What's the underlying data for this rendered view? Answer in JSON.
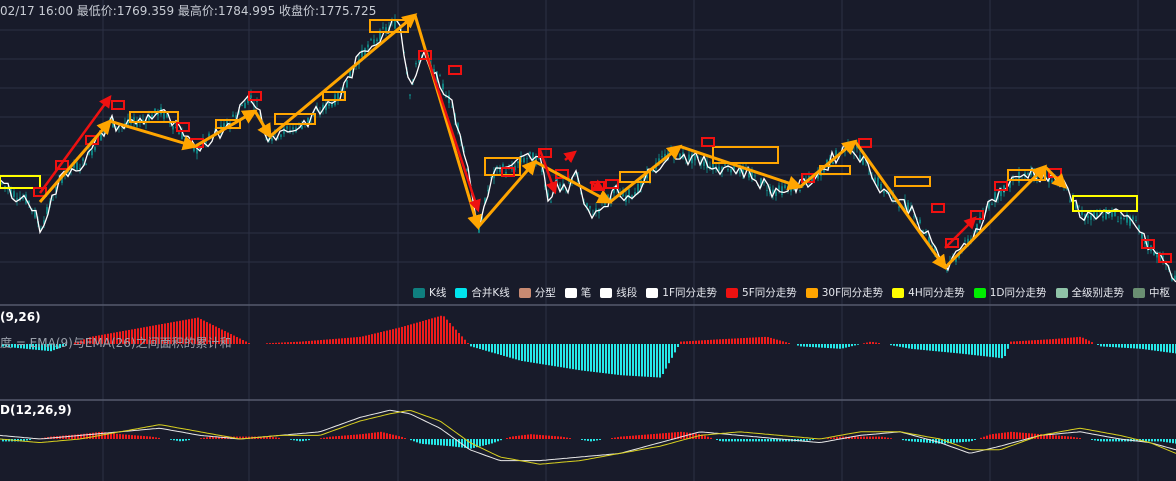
{
  "header": {
    "info": "02/17 16:00 最低价:1769.359 最高价:1784.995 收盘价:1775.725"
  },
  "legend": [
    {
      "label": "K线",
      "color": "#0f7f7f"
    },
    {
      "label": "合并K线",
      "color": "#00e5ee"
    },
    {
      "label": "分型",
      "color": "#c88a72"
    },
    {
      "label": "笔",
      "color": "#ffffff"
    },
    {
      "label": "线段",
      "color": "#ffffff"
    },
    {
      "label": "1F同分走势",
      "color": "#ffffff"
    },
    {
      "label": "5F同分走势",
      "color": "#ee1111"
    },
    {
      "label": "30F同分走势",
      "color": "#ffa500"
    },
    {
      "label": "4H同分走势",
      "color": "#ffff00"
    },
    {
      "label": "1D同分走势",
      "color": "#00ee00"
    },
    {
      "label": "全级别走势",
      "color": "#8fc3a8"
    },
    {
      "label": "中枢",
      "color": "#6a8f72"
    }
  ],
  "panels": {
    "area_title": "(9,26)",
    "area_desc": "度 = EMA(9)与EMA(26)之间面积的累计和",
    "macd_title": "D(12,26,9)"
  },
  "colors": {
    "background": "#181b2a",
    "grid": "#2c3044",
    "up": "#ee1c1c",
    "down": "#26e8e8",
    "kline": "#0f7f7f",
    "bi": "#ffffff",
    "seg30": "#ffa500",
    "seg5": "#ee1111",
    "pivot4h": "#ffff00",
    "dif": "#e8e8e8",
    "dea": "#d8d020"
  },
  "chart_data": [
    {
      "type": "line",
      "name": "price",
      "x": [
        0,
        12,
        30,
        40,
        45,
        55,
        65,
        85,
        110,
        120,
        140,
        160,
        175,
        195,
        205,
        220,
        235,
        250,
        258,
        265,
        270,
        285,
        300,
        320,
        340,
        355,
        365,
        375,
        385,
        400,
        410,
        418,
        425,
        432,
        440,
        450,
        460,
        470,
        478,
        490,
        500,
        510,
        520,
        530,
        540,
        550,
        556,
        565,
        575,
        585,
        595,
        605,
        615,
        625,
        640,
        655,
        670,
        685,
        700,
        715,
        730,
        745,
        760,
        775,
        790,
        800,
        815,
        830,
        845,
        858,
        870,
        885,
        900,
        915,
        930,
        948,
        960,
        975,
        990,
        1005,
        1020,
        1030,
        1045,
        1060,
        1070,
        1085,
        1100,
        1120,
        1135,
        1145,
        1155,
        1165,
        1176
      ],
      "values": [
        1780,
        1778,
        1776,
        1771,
        1773,
        1778,
        1782,
        1784,
        1792,
        1791,
        1792,
        1794,
        1791,
        1786,
        1788,
        1790,
        1793,
        1797,
        1795,
        1790,
        1789,
        1790,
        1791,
        1794,
        1797,
        1803,
        1806,
        1808,
        1810,
        1812,
        1798,
        1804,
        1806,
        1802,
        1800,
        1796,
        1790,
        1780,
        1770,
        1780,
        1783,
        1782,
        1784,
        1785,
        1784,
        1776,
        1780,
        1778,
        1782,
        1775,
        1774,
        1776,
        1778,
        1777,
        1779,
        1783,
        1786,
        1785,
        1784,
        1783,
        1783,
        1782,
        1780,
        1778,
        1779,
        1779,
        1781,
        1784,
        1787,
        1786,
        1782,
        1778,
        1776,
        1774,
        1768,
        1763,
        1766,
        1770,
        1776,
        1779,
        1781,
        1782,
        1781,
        1780,
        1777,
        1773,
        1774,
        1773,
        1772,
        1768,
        1766,
        1764,
        1760
      ],
      "ylim": [
        1758,
        1814
      ]
    },
    {
      "type": "line",
      "name": "30F同分走势",
      "x": [
        40,
        110,
        195,
        255,
        270,
        415,
        478,
        535,
        610,
        680,
        800,
        855,
        945,
        1045,
        1065
      ],
      "values": [
        1776,
        1792,
        1787,
        1794,
        1789,
        1813,
        1771,
        1784,
        1776,
        1787,
        1779,
        1788,
        1763,
        1783,
        1779
      ]
    },
    {
      "type": "bar",
      "name": "EMA(9)-EMA(26) area",
      "x": [
        0,
        50,
        90,
        130,
        170,
        197,
        250,
        300,
        360,
        400,
        442,
        470,
        520,
        580,
        620,
        660,
        680,
        720,
        766,
        800,
        840,
        870,
        910,
        960,
        1003,
        1010,
        1050,
        1080,
        1100,
        1140,
        1176
      ],
      "values": [
        -1,
        -3,
        3,
        6,
        9,
        11,
        0,
        1,
        3,
        7,
        12,
        -1,
        -7,
        -11,
        -13,
        -14,
        1,
        2,
        3,
        -1,
        -2,
        1,
        -2,
        -4,
        -6,
        1,
        2,
        3,
        -1,
        -2,
        -4
      ]
    },
    {
      "type": "bar",
      "name": "MACD",
      "x": [
        0,
        20,
        50,
        80,
        100,
        120,
        150,
        180,
        210,
        240,
        270,
        300,
        330,
        360,
        380,
        400,
        420,
        450,
        470,
        490,
        510,
        530,
        560,
        590,
        620,
        650,
        680,
        700,
        720,
        760,
        800,
        840,
        880,
        910,
        940,
        970,
        990,
        1010,
        1040,
        1070,
        1100,
        1130,
        1160,
        1176
      ],
      "values": [
        -1,
        -1,
        1,
        2,
        3,
        2,
        1,
        -1,
        1,
        1,
        1,
        -1,
        1,
        2,
        3,
        1,
        -2,
        -3,
        -4,
        -2,
        1,
        2,
        1,
        -1,
        1,
        2,
        3,
        2,
        -1,
        -1,
        -1,
        1,
        1,
        -1,
        -2,
        -1,
        2,
        3,
        2,
        1,
        -1,
        -1,
        -1,
        -2
      ]
    },
    {
      "type": "line",
      "name": "DIF/DEA",
      "x": [
        0,
        40,
        80,
        120,
        160,
        200,
        240,
        280,
        320,
        360,
        390,
        410,
        440,
        470,
        500,
        540,
        580,
        620,
        660,
        700,
        740,
        780,
        820,
        860,
        900,
        940,
        970,
        1000,
        1040,
        1080,
        1120,
        1150,
        1176
      ],
      "series": [
        {
          "values": [
            1,
            0,
            1,
            2,
            3,
            1,
            0,
            1,
            2,
            6,
            8,
            7,
            3,
            -3,
            -6,
            -6,
            -5,
            -4,
            -1,
            2,
            1,
            0,
            -1,
            1,
            2,
            -1,
            -4,
            -2,
            1,
            2,
            0,
            -1,
            -3
          ]
        },
        {
          "values": [
            0,
            -1,
            0,
            2,
            4,
            2,
            0,
            1,
            1,
            5,
            7,
            8,
            5,
            -1,
            -5,
            -7,
            -6,
            -4,
            -2,
            1,
            2,
            1,
            0,
            2,
            2,
            0,
            -3,
            -3,
            1,
            3,
            1,
            -1,
            -4
          ]
        }
      ]
    }
  ]
}
